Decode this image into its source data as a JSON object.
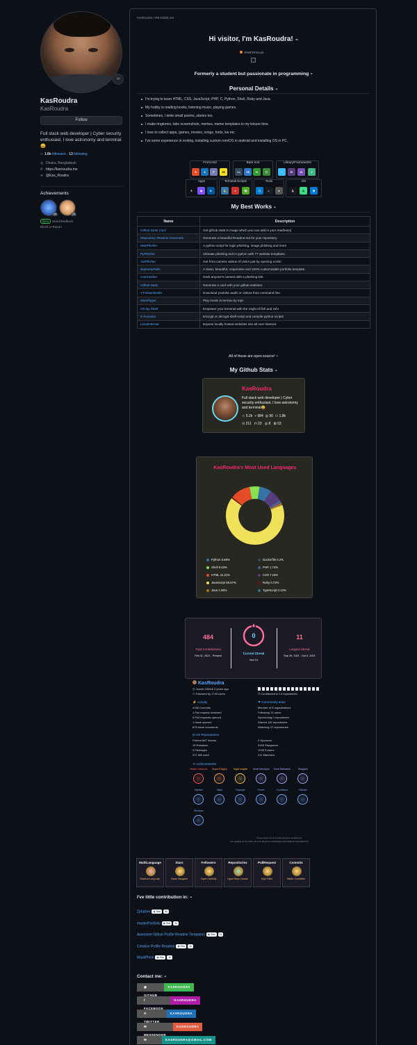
{
  "profile": {
    "name": "KasRoudra",
    "username": "KasRoudra",
    "status_emoji": "∞",
    "follow_label": "Follow",
    "bio": "Full stack web developer | Cyber security enthusiast. I love astronomy and terminal😄",
    "followers_count": "1.8k",
    "followers_label": "followers",
    "separator": "·",
    "following_count": "13",
    "following_label": "following",
    "location": "Dhaka, Bangladesh",
    "website": "https://kasroudra.me",
    "twitter": "@Kas_Roudra",
    "achievements_title": "Achievements",
    "achievement_counts": [
      "x2",
      "x3"
    ],
    "beta_tag": "Beta",
    "beta_text": "Send feedback",
    "block_label": "Block or Report"
  },
  "readme": {
    "path": "KasRoudra / README.md",
    "heading": "Hi visitor, I'm KasRoudra!",
    "portfolio_badge": "PORTFOLIO",
    "tagline": "Formerly a student but passionate in programming",
    "personal_title": "Personal Details",
    "personal_items": [
      "I'm trying to learn HTML, CSS, JavaScript, PHP, C, Python, Shell, Ruby and Java.",
      "My hobby is reading books, listening music, playing games.",
      "Sometimes, I write small poems, stories too.",
      "I make ringtones, take screenshots, memes, meme templates in my leisure time.",
      "I love to collect apps, games, movies, songs, fonts, kw etc.",
      "I've some experience in rooting, installing custom rom/OS in android and installing OS in PC."
    ],
    "skill_groups": [
      "Front end",
      "Back end",
      "Library/Frameworks",
      "Apps",
      "Terminal Scripts",
      "Tools",
      "OS"
    ],
    "skill_icons": {
      "frontend": [
        "5",
        "3",
        "P",
        "JS"
      ],
      "backend": [
        "<>",
        "TS",
        "N",
        "⬡"
      ],
      "libs": [
        "~",
        "B",
        "B",
        "V"
      ],
      "apps": [
        "✈",
        "◆",
        "K"
      ],
      "terminal": [
        "🐍",
        "♦",
        "🐚"
      ],
      "tools": [
        "⟨⟩",
        ">_",
        "●"
      ],
      "os": [
        "🐧",
        "A",
        "⊞"
      ]
    },
    "works_title": "My Best Works",
    "table_headers": [
      "Name",
      "Description"
    ],
    "works": [
      {
        "name": "Github Stats Card",
        "desc": "Get github stats in image which you can add in your readme(s)"
      },
      {
        "name": "Repository Readme Generator",
        "desc": "Generate a beautiful Readme.md for your repository."
      },
      {
        "name": "MaxPhisher",
        "desc": "A python script for login phishing, image phishing and more"
      },
      {
        "name": "PyPhisher",
        "desc": "Ultimate phishing tool in python with 77 website templates."
      },
      {
        "name": "VidPhisher",
        "desc": "Get front camera videos of victim just by opening a link!"
      },
      {
        "name": "SupremePolio",
        "desc": "A clean, beautiful, responsive and 100% customizable portfolio template."
      },
      {
        "name": "CamHacker",
        "desc": "Hack anyone's camera with a phishing link."
      },
      {
        "name": "Github Stats",
        "desc": "Generate a card with your github statistics"
      },
      {
        "name": "YT-Downloader",
        "desc": "Download youtube audio or videos from command line."
      },
      {
        "name": "MusiPlayer",
        "desc": "Play music in termux by mpv"
      },
      {
        "name": "Oh My Shell",
        "desc": "Empower your terminal with the might of fish and zsh!"
      },
      {
        "name": "K-Fuscator",
        "desc": "Encrypt or decrypt shell script and compile python scripts"
      },
      {
        "name": "LocalInternet",
        "desc": "Expose locally hosted websites into all over internet."
      }
    ],
    "open_source_note": "All of these are open source!",
    "stats_title": "My Github Stats",
    "stats_card": {
      "name": "KasRoudra",
      "bio": "Full stack web developer | Cyber security enthusiast. I love astronomy and terminal😄",
      "row1": [
        "☆ 5.2k",
        "⑂ 984",
        "◎ 90",
        "⚇ 1.8k"
      ],
      "row2": [
        "⊙ 211",
        "⊓ 23",
        "◎ 8",
        "⊞ 53"
      ]
    },
    "langs_card": {
      "title": "KasRoudra's Most Used Languages",
      "items": [
        {
          "label": "Python 6.69%",
          "color": "#3572a5"
        },
        {
          "label": "Dockerfile 0.2%",
          "color": "#384d54"
        },
        {
          "label": "Shell 5.63%",
          "color": "#89e051"
        },
        {
          "label": "PHP 1.74%",
          "color": "#4f5d95"
        },
        {
          "label": "HTML 11.21%",
          "color": "#e34c26"
        },
        {
          "label": "CSS 7.15%",
          "color": "#563d7c"
        },
        {
          "label": "JavaScript 66.67%",
          "color": "#f1e05a"
        },
        {
          "label": "Ruby 0.72%",
          "color": "#701516"
        },
        {
          "label": "Java 1.06%",
          "color": "#b07219"
        },
        {
          "label": "TypeScript 0.13%",
          "color": "#2b7489"
        }
      ]
    },
    "streak_card": {
      "total": "484",
      "total_label": "Total Contributions",
      "total_range": "Feb 11, 2021 - Present",
      "current": "0",
      "current_label": "Current Streak",
      "current_range": "Nov 14",
      "longest": "11",
      "longest_label": "Longest Streak",
      "longest_range": "Sep 29, 2021 - Oct 9, 2021"
    },
    "metrics": {
      "name": "KasRoudra",
      "joined": "Joined GitHub 2 years ago",
      "followed": "Followed by 1749 users",
      "contributed": "Contributed to 13 repositories",
      "activity_title": "Activity",
      "activity": [
        "4768 Commits",
        "1 Pull request reviewed",
        "8 Pull requests opened",
        "1 Issue opened",
        "875 issue comments"
      ],
      "community_title": "Community stats",
      "community": [
        "Member of 8 organizations",
        "Following 13 users",
        "Sponsoring 0 repositories",
        "Starred 116 repositories",
        "Watching 37 repositories"
      ],
      "repos_title": "XX Repositories",
      "repos": [
        "Prefers MIT license",
        "15 Releases",
        "0 Packages",
        "371 MB used"
      ],
      "repos_right": [
        "0 Sponsors",
        "5168 Stargazers",
        "1035 Forkers",
        "211 Watchers"
      ],
      "achievements_title": "Achievements",
      "badges": [
        "Master Influencer",
        "Super Polyglot",
        "Super Inspirer",
        "Great Developer",
        "Great Maintainer",
        "Stargazer",
        "Member",
        "Sister",
        "Deployer",
        "Forker",
        "Contributor",
        "Follower",
        "Reviewer"
      ],
      "footer1": "These metrics do not include all private contributions",
      "footer2": "Last updated 14 Nov 2022, 15:11:22 (timezone Asia/Dhaka) with lowlighter/metrics@3.30.0"
    },
    "trophies": [
      {
        "title": "MultiLanguage",
        "rank": "Rainbow Lang User"
      },
      {
        "title": "Stars",
        "rank": "Super Stargazer"
      },
      {
        "title": "Followers",
        "rank": "Super Celebrity"
      },
      {
        "title": "Repositories",
        "rank": "Hyper Repo Creator"
      },
      {
        "title": "PullRequest",
        "rank": "High Puller"
      },
      {
        "title": "Commits",
        "rank": "Middle Committer"
      }
    ],
    "contrib_title": "I've little contribution in:",
    "contributions": [
      {
        "name": "Zphisher",
        "star": "Star",
        "count": "8k"
      },
      {
        "name": "masterPortfolio",
        "star": "Star",
        "count": "1k"
      },
      {
        "name": "Awesome Github Profile Readme Templates",
        "star": "Star",
        "count": "1k"
      },
      {
        "name": "Creative Profile Readme",
        "star": "Star",
        "count": "1k"
      },
      {
        "name": "MaskPhish",
        "star": "Star",
        "count": "1k"
      }
    ],
    "contact_title": "Contact me:",
    "contacts": [
      {
        "label": "GITHUB",
        "value": "KASROUDRA",
        "color": "#3fb950"
      },
      {
        "label": "FACEBOOK",
        "value": "KASROUDRA",
        "color": "#b01ca8"
      },
      {
        "label": "TWITTER",
        "value": "KASROUDRA",
        "color": "#1d6fb8"
      },
      {
        "label": "MESSENGER",
        "value": "KASROUDRA",
        "color": "#e05d44"
      },
      {
        "label": "EMAIL",
        "value": "KASROUDRA@GMAIL.COM",
        "color": "#17938c"
      }
    ]
  }
}
